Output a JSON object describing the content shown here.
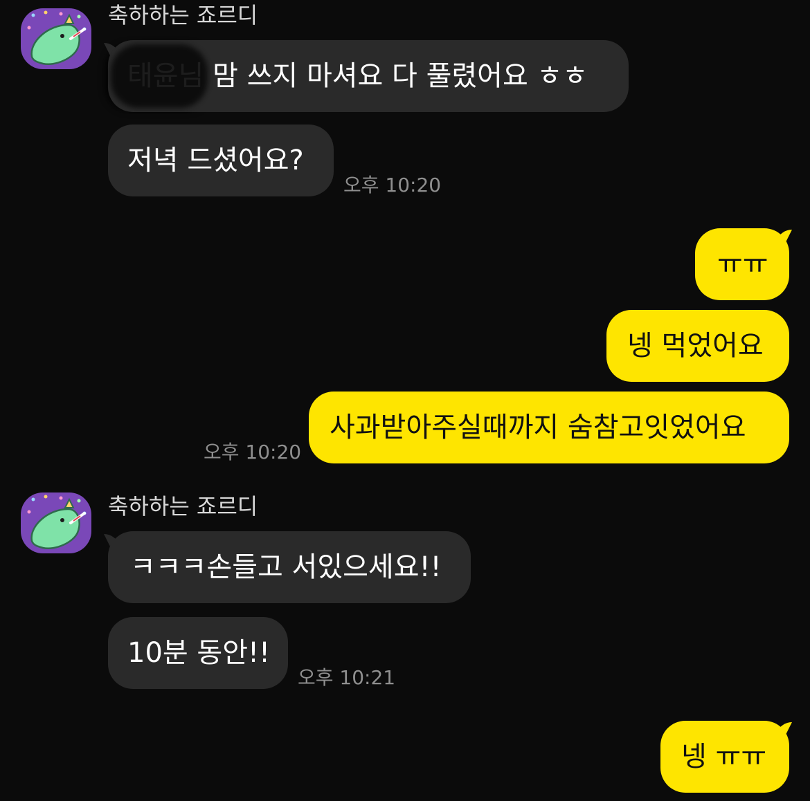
{
  "chat": {
    "sender_name": "축하하는 죠르디",
    "group1": {
      "msg1": "태윤님 맘 쓰지 마셔요 다 풀렸어요 ㅎㅎ",
      "msg2": "저녁 드셨어요?",
      "time": "오후 10:20"
    },
    "my1": {
      "msg1": "ㅠㅠ",
      "msg2": "넹 먹었어요",
      "msg3": "사과받아주실때까지 숨참고잇었어요",
      "time": "오후 10:20"
    },
    "group2": {
      "msg1": "ㅋㅋㅋ손들고 서있으세요!!",
      "msg2": "10분 동안!!",
      "time": "오후 10:21"
    },
    "my2": {
      "msg1": "넹 ㅠㅠ"
    }
  },
  "colors": {
    "background": "#0b0b0b",
    "received_bubble": "#2a2a2a",
    "sent_bubble": "#fee500",
    "avatar_bg": "#7a48b8",
    "character_green": "#7fe2a8"
  },
  "icons": {
    "avatar": "jordy-dinosaur-party-icon"
  }
}
